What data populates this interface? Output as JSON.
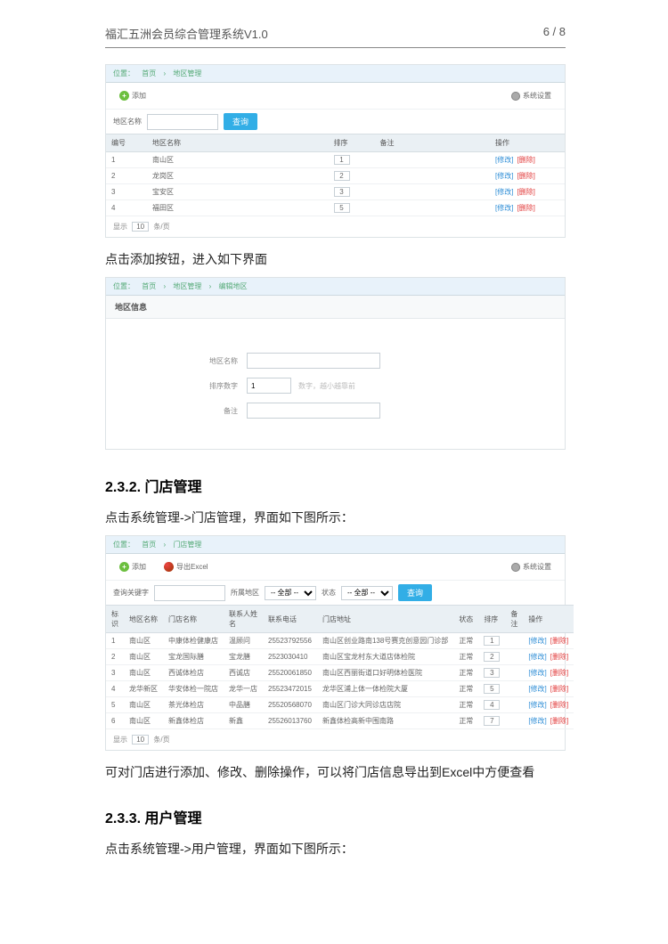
{
  "header": {
    "title": "福汇五洲会员综合管理系统V1.0",
    "page": "6 / 8"
  },
  "screenshot1": {
    "breadcrumb": [
      "位置：",
      "首页",
      "地区管理"
    ],
    "add_label": "添加",
    "settings_label": "系统设置",
    "filter_label": "地区名称",
    "search_label": "查询",
    "cols": [
      "编号",
      "地区名称",
      "排序",
      "备注",
      "操作"
    ],
    "rows": [
      {
        "id": "1",
        "name": "南山区",
        "sort": "1",
        "note": "",
        "edit": "[修改]",
        "del": "[删除]"
      },
      {
        "id": "2",
        "name": "龙岗区",
        "sort": "2",
        "note": "",
        "edit": "[修改]",
        "del": "[删除]"
      },
      {
        "id": "3",
        "name": "宝安区",
        "sort": "3",
        "note": "",
        "edit": "[修改]",
        "del": "[删除]"
      },
      {
        "id": "4",
        "name": "福田区",
        "sort": "5",
        "note": "",
        "edit": "[修改]",
        "del": "[删除]"
      }
    ],
    "pager_prefix": "显示",
    "pager_num": "10",
    "pager_suffix": "条/页"
  },
  "caption1": "点击添加按钮，进入如下界面",
  "screenshot2": {
    "breadcrumb": [
      "位置：",
      "首页",
      "地区管理",
      "编辑地区"
    ],
    "form_title": "地区信息",
    "name_label": "地区名称",
    "sort_label": "排序数字",
    "sort_value": "1",
    "sort_hint": "数字，越小越靠前",
    "note_label": "备注"
  },
  "section232": "2.3.2. 门店管理",
  "caption2": "点击系统管理->门店管理，界面如下图所示：",
  "screenshot3": {
    "breadcrumb": [
      "位置：",
      "首页",
      "门店管理"
    ],
    "add_label": "添加",
    "export_label": "导出Excel",
    "settings_label": "系统设置",
    "filter_kw_label": "查询关键字",
    "filter_region_label": "所属地区",
    "filter_region_val": "-- 全部 --",
    "filter_status_label": "状态",
    "filter_status_val": "-- 全部 --",
    "search_label": "查询",
    "cols": [
      "标识",
      "地区名称",
      "门店名称",
      "联系人姓名",
      "联系电话",
      "门店地址",
      "状态",
      "排序",
      "备注",
      "操作"
    ],
    "rows": [
      {
        "c": [
          "1",
          "南山区",
          "中康体检健康店",
          "温顾问",
          "25523792556",
          "南山区创业路南138号赛克创意园门诊部",
          "正常",
          "1",
          "",
          "[修改] [删除]"
        ]
      },
      {
        "c": [
          "2",
          "南山区",
          "宝龙国际膳",
          "宝龙膳",
          "2523030410",
          "南山区宝龙村东大道店体检院",
          "正常",
          "2",
          "",
          "[修改] [删除]"
        ]
      },
      {
        "c": [
          "3",
          "南山区",
          "西诚体检店",
          "西诚店",
          "25520061850",
          "南山区西丽街道口好明体检医院",
          "正常",
          "3",
          "",
          "[修改] [删除]"
        ]
      },
      {
        "c": [
          "4",
          "龙华新区",
          "华安体检一院店",
          "龙华一店",
          "25523472015",
          "龙华区浦上体一体检院大厦",
          "正常",
          "5",
          "",
          "[修改] [删除]"
        ]
      },
      {
        "c": [
          "5",
          "南山区",
          "茶光体检店",
          "中品膳",
          "25520568070",
          "南山区门诊大同诊店店院",
          "正常",
          "4",
          "",
          "[修改] [删除]"
        ]
      },
      {
        "c": [
          "6",
          "南山区",
          "新鑫体检店",
          "新鑫",
          "25526013760",
          "新鑫体检高新中围南路",
          "正常",
          "7",
          "",
          "[修改] [删除]"
        ]
      }
    ],
    "pager_prefix": "显示",
    "pager_num": "10",
    "pager_suffix": "条/页"
  },
  "caption3": "可对门店进行添加、修改、删除操作，可以将门店信息导出到Excel中方便查看",
  "section233": "2.3.3. 用户管理",
  "caption4": "点击系统管理->用户管理，界面如下图所示："
}
